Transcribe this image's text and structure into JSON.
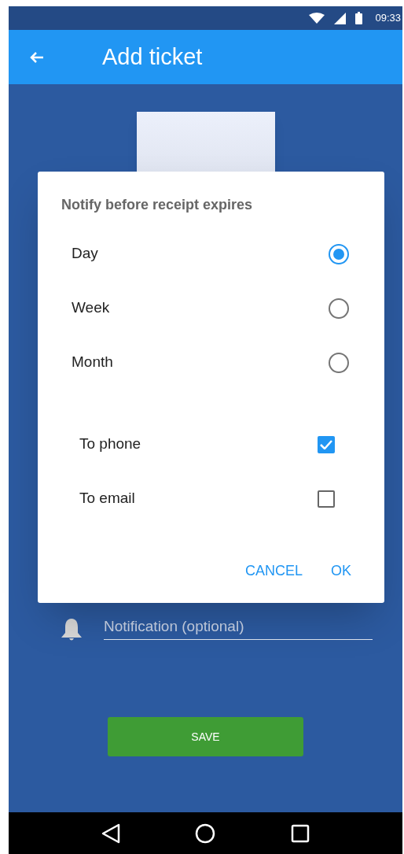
{
  "status_bar": {
    "time": "09:33"
  },
  "app_bar": {
    "title": "Add ticket"
  },
  "notification_field": {
    "placeholder": "Notification (optional)"
  },
  "save_button": "SAVE",
  "dialog": {
    "title": "Notify before receipt expires",
    "options": [
      {
        "label": "Day",
        "selected": true
      },
      {
        "label": "Week",
        "selected": false
      },
      {
        "label": "Month",
        "selected": false
      }
    ],
    "targets": [
      {
        "label": "To phone",
        "checked": true
      },
      {
        "label": "To email",
        "checked": false
      }
    ],
    "buttons": [
      "CANCEL",
      "OK"
    ]
  }
}
